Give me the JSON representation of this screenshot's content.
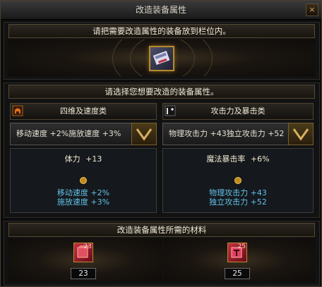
{
  "window": {
    "title": "改造装备属性",
    "close_label": "×"
  },
  "slot_section": {
    "header": "请把需要改造属性的装备放到栏位内。"
  },
  "attribute_section": {
    "header": "请选择您想要改造的装备属性。",
    "left": {
      "category": "四维及速度类",
      "selected": "移动速度 +2%施放速度 +3%",
      "main_label": "体力",
      "main_value": "+13",
      "lines": [
        {
          "label": "移动速度",
          "value": "+2%"
        },
        {
          "label": "施放速度",
          "value": "+3%"
        }
      ]
    },
    "right": {
      "category": "攻击力及暴击类",
      "selected": "物理攻击力 +43独立攻击力 +52",
      "main_label": "魔法暴击率",
      "main_value": "+6%",
      "lines": [
        {
          "label": "物理攻击力",
          "value": "+43"
        },
        {
          "label": "独立攻击力",
          "value": "+52"
        }
      ]
    }
  },
  "materials_section": {
    "header": "改造装备属性所需的材料",
    "items": [
      {
        "badge": "23",
        "count": "23"
      },
      {
        "badge": "25",
        "count": "25"
      }
    ]
  },
  "colors": {
    "gold_border": "#b8892e",
    "stat_blue": "#62c0e8",
    "panel_bg": "#121212"
  },
  "icons": {
    "close": "close-icon",
    "stat_category": "helmet-icon",
    "attack_category": "sword-plus-icon",
    "dropdown": "chevron-down-icon",
    "material": "red-cube-icon"
  }
}
